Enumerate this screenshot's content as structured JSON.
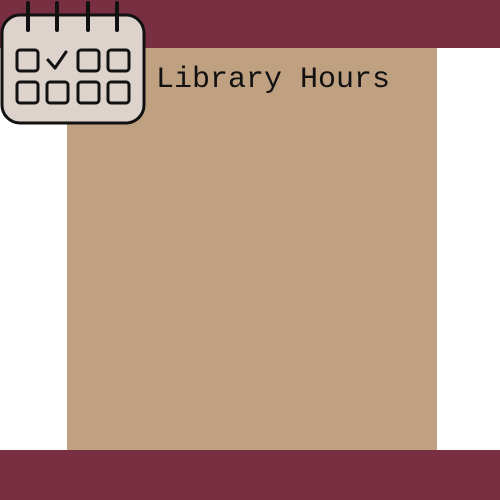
{
  "header": {
    "title": "Library Hours",
    "icon": "calendar-icon"
  },
  "colors": {
    "bar": "#772f41",
    "panel": "#bfa080",
    "background": "#ffffff",
    "icon_fill": "#ddd3cc"
  }
}
